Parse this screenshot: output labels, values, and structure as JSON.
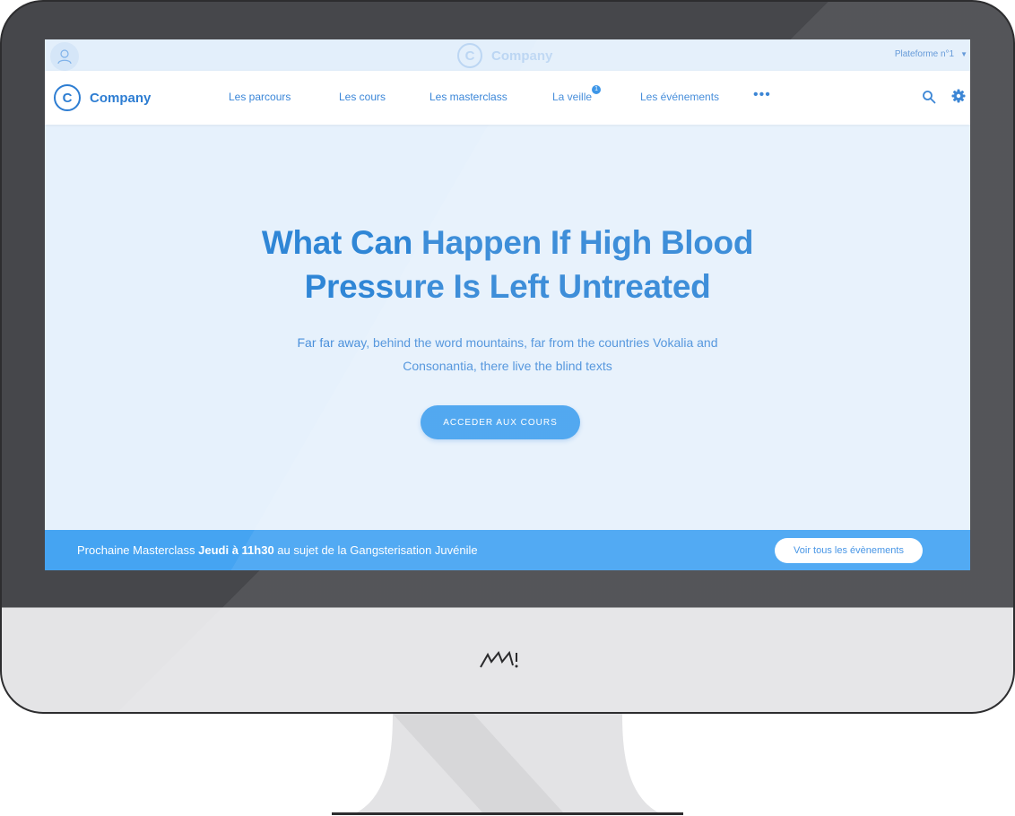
{
  "topbar": {
    "brand": "Company",
    "brand_logo_letter": "C",
    "platform": "Plateforme n°1"
  },
  "navbar": {
    "brand": "Company",
    "brand_logo_letter": "C",
    "items": [
      {
        "label": "Les parcours"
      },
      {
        "label": "Les cours"
      },
      {
        "label": "Les masterclass"
      },
      {
        "label": "La veille",
        "badge": "1"
      },
      {
        "label": "Les événements"
      }
    ],
    "more": "•••"
  },
  "hero": {
    "title": "What Can Happen If High Blood Pressure Is Left Untreated",
    "subtitle": "Far far away, behind the word mountains, far from the countries Vokalia and Consonantia, there live the blind texts",
    "cta": "ACCEDER AUX COURS"
  },
  "promo": {
    "prefix": "Prochaine Masterclass ",
    "highlight": "Jeudi à 11h30",
    "suffix": " au sujet de la Gangsterisation Juvénile",
    "button": "Voir tous les évènements"
  },
  "colors": {
    "accent": "#2d7dd2",
    "hero_bg": "#e6f1fc",
    "cta": "#45a2ef",
    "promo_bg": "#45a4f2",
    "bezel": "#46474b",
    "chin": "#e4e4e6"
  },
  "icons": [
    "user-avatar-icon",
    "caret-down-icon",
    "search-icon",
    "gear-icon",
    "brand-logo-icon"
  ]
}
